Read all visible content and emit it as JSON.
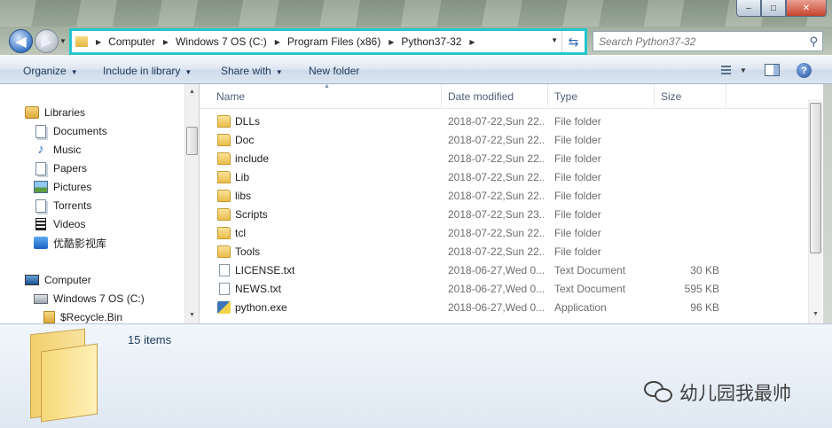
{
  "window": {
    "caption_buttons": [
      "–",
      "□",
      "✕"
    ]
  },
  "nav": {
    "back_glyph": "◀",
    "forward_glyph": "▶",
    "breadcrumbs": [
      "Computer",
      "Windows 7 OS (C:)",
      "Program Files (x86)",
      "Python37-32"
    ],
    "search_placeholder": "Search Python37-32"
  },
  "toolbar": {
    "organize": "Organize",
    "include_in_library": "Include in library",
    "share_with": "Share with",
    "new_folder": "New folder"
  },
  "sidebar": {
    "libraries": {
      "label": "Libraries",
      "items": [
        "Documents",
        "Music",
        "Papers",
        "Pictures",
        "Torrents",
        "Videos",
        "优酷影视库"
      ]
    },
    "computer": {
      "label": "Computer",
      "items": [
        "Windows 7 OS (C:)",
        "$Recycle.Bin"
      ]
    }
  },
  "file_list": {
    "columns": {
      "name": "Name",
      "date": "Date modified",
      "type": "Type",
      "size": "Size"
    },
    "rows": [
      {
        "name": "DLLs",
        "date": "2018-07-22,Sun 22...",
        "type": "File folder",
        "size": "",
        "icon": "folder-icon"
      },
      {
        "name": "Doc",
        "date": "2018-07-22,Sun 22...",
        "type": "File folder",
        "size": "",
        "icon": "folder-icon"
      },
      {
        "name": "include",
        "date": "2018-07-22,Sun 22...",
        "type": "File folder",
        "size": "",
        "icon": "folder-icon"
      },
      {
        "name": "Lib",
        "date": "2018-07-22,Sun 22...",
        "type": "File folder",
        "size": "",
        "icon": "folder-icon"
      },
      {
        "name": "libs",
        "date": "2018-07-22,Sun 22...",
        "type": "File folder",
        "size": "",
        "icon": "folder-icon"
      },
      {
        "name": "Scripts",
        "date": "2018-07-22,Sun 23...",
        "type": "File folder",
        "size": "",
        "icon": "folder-icon"
      },
      {
        "name": "tcl",
        "date": "2018-07-22,Sun 22...",
        "type": "File folder",
        "size": "",
        "icon": "folder-icon"
      },
      {
        "name": "Tools",
        "date": "2018-07-22,Sun 22...",
        "type": "File folder",
        "size": "",
        "icon": "folder-icon"
      },
      {
        "name": "LICENSE.txt",
        "date": "2018-06-27,Wed 0...",
        "type": "Text Document",
        "size": "30 KB",
        "icon": "text-file-icon"
      },
      {
        "name": "NEWS.txt",
        "date": "2018-06-27,Wed 0...",
        "type": "Text Document",
        "size": "595 KB",
        "icon": "text-file-icon"
      },
      {
        "name": "python.exe",
        "date": "2018-06-27,Wed 0...",
        "type": "Application",
        "size": "96 KB",
        "icon": "python-exe-icon"
      }
    ]
  },
  "details": {
    "item_count": "15 items"
  },
  "watermark": {
    "text": "幼儿园我最帅"
  },
  "colors": {
    "address_highlight": "#22c6cc",
    "command_text": "#1e395b",
    "folder": "#e9bd4a"
  }
}
